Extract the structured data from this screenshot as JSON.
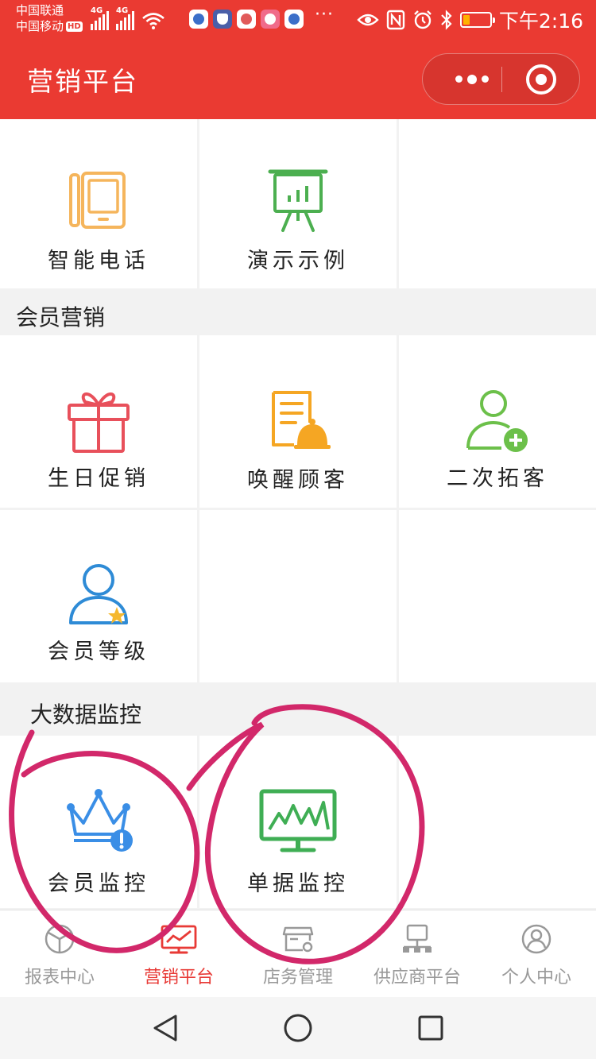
{
  "status_bar": {
    "carrier_1": "中国联通",
    "carrier_2": "中国移动",
    "hd_badge": "HD",
    "network_1": "4G",
    "network_2": "4G",
    "more": "···",
    "time": "下午2:16"
  },
  "header": {
    "title": "营销平台"
  },
  "sections": {
    "top": {
      "items": [
        {
          "label": "智能电话",
          "icon": "phone-icon",
          "color": "#f5b55c"
        },
        {
          "label": "演示示例",
          "icon": "presentation-board-icon",
          "color": "#4caf50"
        }
      ]
    },
    "member_marketing": {
      "title": "会员营销",
      "items": [
        {
          "label": "生日促销",
          "icon": "gift-icon",
          "color": "#e8505b"
        },
        {
          "label": "唤醒顾客",
          "icon": "document-bell-icon",
          "color": "#f5a623"
        },
        {
          "label": "二次拓客",
          "icon": "user-add-icon",
          "color": "#6cc04a"
        },
        {
          "label": "会员等级",
          "icon": "user-star-icon",
          "color": "#2e8bd6"
        }
      ]
    },
    "big_data": {
      "title": "大数据监控",
      "items": [
        {
          "label": "会员监控",
          "icon": "crown-alert-icon",
          "color": "#3a8ee6"
        },
        {
          "label": "单据监控",
          "icon": "monitor-chart-icon",
          "color": "#3fae54"
        }
      ]
    }
  },
  "tabbar": {
    "items": [
      {
        "label": "报表中心",
        "icon": "pie-chart-icon",
        "active": false
      },
      {
        "label": "营销平台",
        "icon": "screen-trend-icon",
        "active": true
      },
      {
        "label": "店务管理",
        "icon": "store-settings-icon",
        "active": false
      },
      {
        "label": "供应商平台",
        "icon": "network-server-icon",
        "active": false
      },
      {
        "label": "个人中心",
        "icon": "user-circle-icon",
        "active": false
      }
    ],
    "active_color": "#e83a36",
    "inactive_color": "#999999"
  },
  "colors": {
    "brand": "#ea3a32",
    "annotation": "#d2286a"
  }
}
